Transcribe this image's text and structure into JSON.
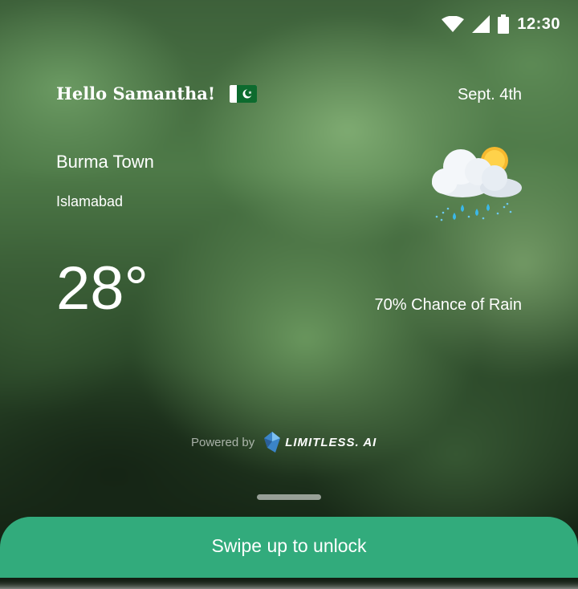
{
  "status_bar": {
    "time": "12:30",
    "icons": [
      "wifi-icon",
      "signal-icon",
      "battery-icon"
    ]
  },
  "greeting": {
    "text": "Hello Samantha!",
    "flag_icon": "pakistan-flag-icon"
  },
  "date": "Sept. 4th",
  "location": {
    "city": "Burma Town",
    "region": "Islamabad"
  },
  "weather": {
    "icon": "rain-cloud-sun-icon",
    "temperature": "28°",
    "rain_chance": "70% Chance of Rain"
  },
  "footer": {
    "powered_by": "Powered by",
    "brand": "LIMITLESS. AI",
    "brand_icon": "limitless-logo-icon"
  },
  "unlock": {
    "label": "Swipe up to unlock",
    "color": "#32ab7c"
  }
}
